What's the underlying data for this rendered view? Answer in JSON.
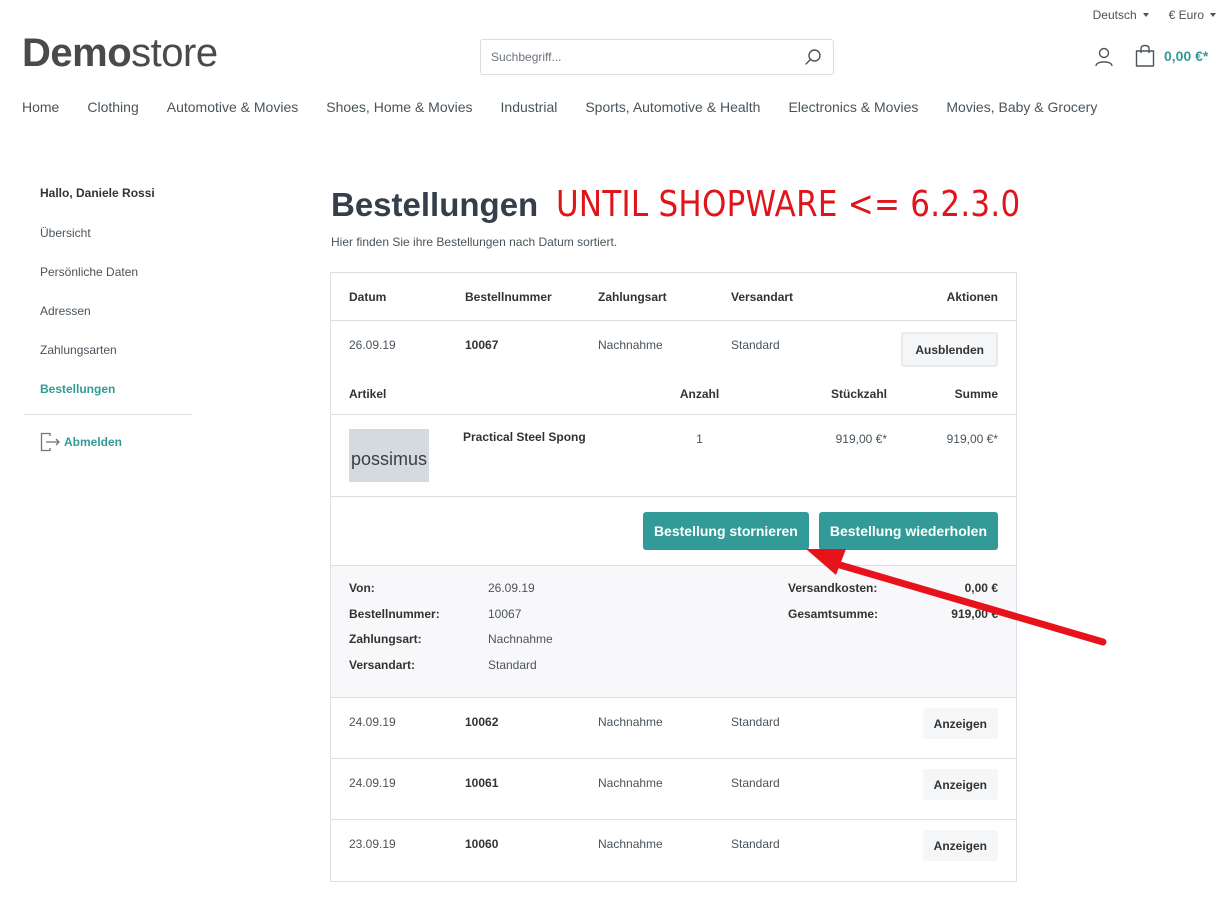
{
  "topbar": {
    "language": "Deutsch",
    "currency": "€ Euro"
  },
  "header": {
    "logo_bold": "Demo",
    "logo_light": "store",
    "search_placeholder": "Suchbegriff...",
    "cart_amount": "0,00 €*"
  },
  "nav": {
    "items": [
      "Home",
      "Clothing",
      "Automotive & Movies",
      "Shoes, Home & Movies",
      "Industrial",
      "Sports, Automotive & Health",
      "Electronics & Movies",
      "Movies, Baby & Grocery"
    ]
  },
  "sidebar": {
    "greeting": "Hallo, Daniele Rossi",
    "items": [
      "Übersicht",
      "Persönliche Daten",
      "Adressen",
      "Zahlungsarten",
      "Bestellungen"
    ],
    "active": "Bestellungen",
    "logout": "Abmelden"
  },
  "page": {
    "title": "Bestellungen",
    "annotation": "UNTIL SHOPWARE <= 6.2.3.0",
    "subtitle": "Hier finden Sie ihre Bestellungen nach Datum sortiert."
  },
  "orders": {
    "columns": [
      "Datum",
      "Bestellnummer",
      "Zahlungsart",
      "Versandart",
      "Aktionen"
    ],
    "expanded": {
      "date": "26.09.19",
      "number": "10067",
      "payment": "Nachnahme",
      "shipping": "Standard",
      "action": "Ausblenden",
      "item_columns": [
        "Artikel",
        "Anzahl",
        "Stückzahl",
        "Summe"
      ],
      "items": [
        {
          "thumb_text": "possimus",
          "name": "Practical Steel Spong",
          "quantity": "1",
          "unit_price": "919,00 €*",
          "total": "919,00 €*"
        }
      ],
      "cancel_label": "Bestellung stornieren",
      "repeat_label": "Bestellung wiederholen",
      "details": {
        "from_label": "Von:",
        "from_value": "26.09.19",
        "number_label": "Bestellnummer:",
        "number_value": "10067",
        "payment_label": "Zahlungsart:",
        "payment_value": "Nachnahme",
        "shipping_label": "Versandart:",
        "shipping_value": "Standard",
        "shipping_cost_label": "Versandkosten:",
        "shipping_cost_value": "0,00 €",
        "total_label": "Gesamtsumme:",
        "total_value": "919,00 €"
      }
    },
    "rows": [
      {
        "date": "24.09.19",
        "number": "10062",
        "payment": "Nachnahme",
        "shipping": "Standard",
        "action": "Anzeigen"
      },
      {
        "date": "24.09.19",
        "number": "10061",
        "payment": "Nachnahme",
        "shipping": "Standard",
        "action": "Anzeigen"
      },
      {
        "date": "23.09.19",
        "number": "10060",
        "payment": "Nachnahme",
        "shipping": "Standard",
        "action": "Anzeigen"
      }
    ]
  },
  "colors": {
    "accent": "#339b97",
    "annotation": "#e0151b"
  }
}
